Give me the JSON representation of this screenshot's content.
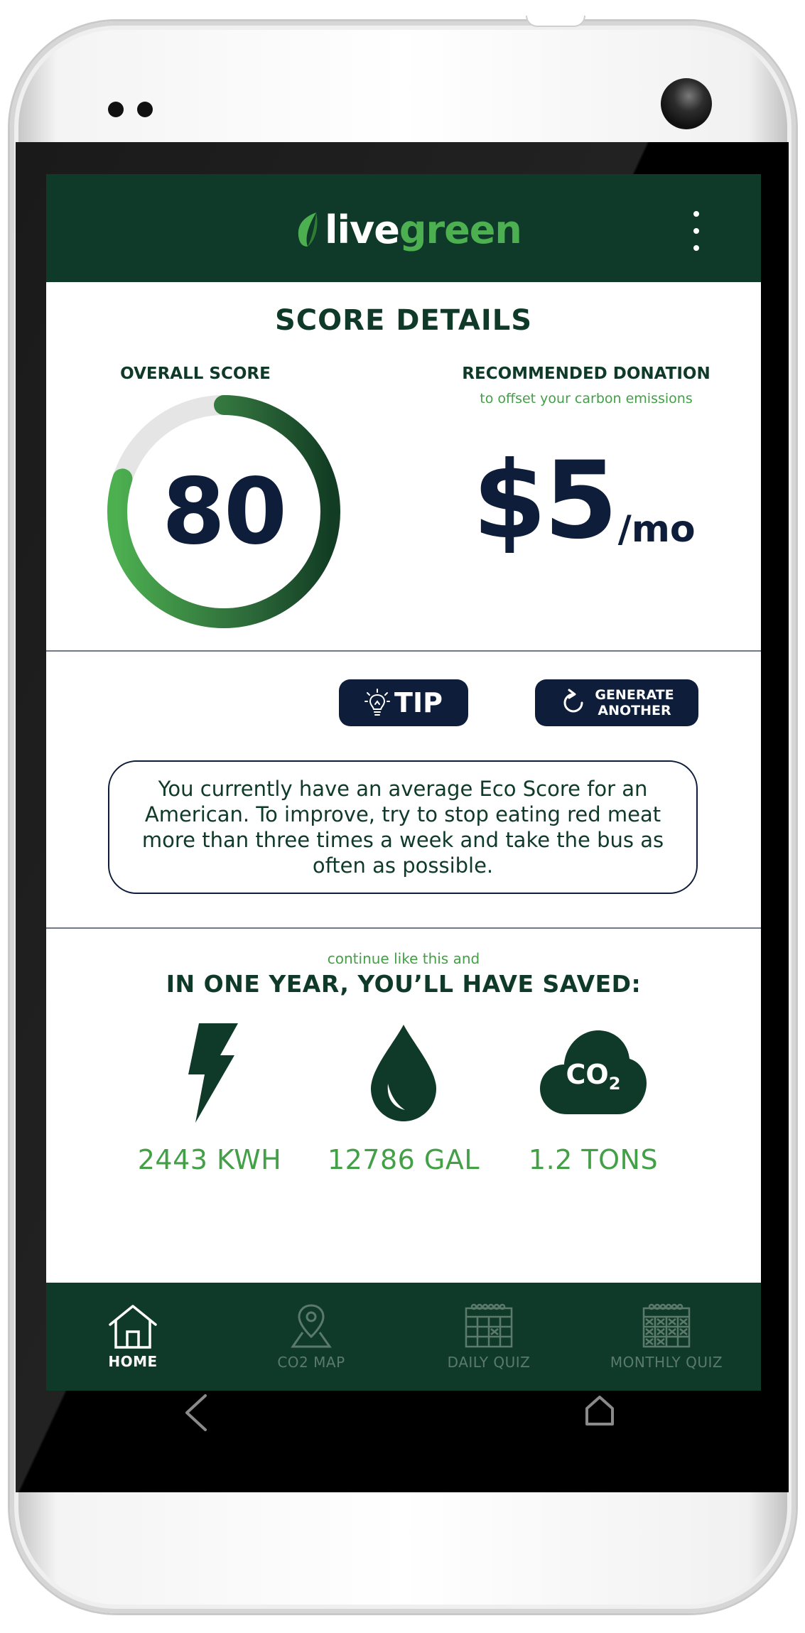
{
  "app": {
    "logo_live": "live",
    "logo_green": "green",
    "brand_dark": "#0f3a29",
    "brand_green": "#4caf50",
    "navy": "#0e1d3a"
  },
  "score": {
    "title": "SCORE DETAILS",
    "overall_label": "OVERALL SCORE",
    "value": "80",
    "value_fraction": 0.8
  },
  "donation": {
    "label": "RECOMMENDED DONATION",
    "sublabel": "to offset your carbon emissions",
    "amount": "$5",
    "unit": "/mo"
  },
  "tip": {
    "tip_label": "TIP",
    "generate_line1": "GENERATE",
    "generate_line2": "ANOTHER",
    "message": "You currently have an average Eco Score for an American. To improve, try to stop eating red meat more than three times a week and take the bus as often as possible."
  },
  "savings": {
    "intro": "continue like this and",
    "title": "IN ONE YEAR, YOU’LL HAVE SAVED:",
    "items": [
      {
        "icon": "lightning-icon",
        "value": "2443 KWH"
      },
      {
        "icon": "water-drop-icon",
        "value": "12786 GAL"
      },
      {
        "icon": "co2-cloud-icon",
        "icon_text": "CO",
        "icon_sub": "2",
        "value": "1.2 TONS"
      }
    ]
  },
  "nav": {
    "items": [
      {
        "label": "HOME",
        "icon": "home-icon",
        "active": true
      },
      {
        "label": "CO2 MAP",
        "icon": "map-pin-icon",
        "active": false
      },
      {
        "label": "DAILY QUIZ",
        "icon": "calendar-icon",
        "active": false
      },
      {
        "label": "MONTHLY QUIZ",
        "icon": "calendar-grid-icon",
        "active": false
      }
    ]
  }
}
